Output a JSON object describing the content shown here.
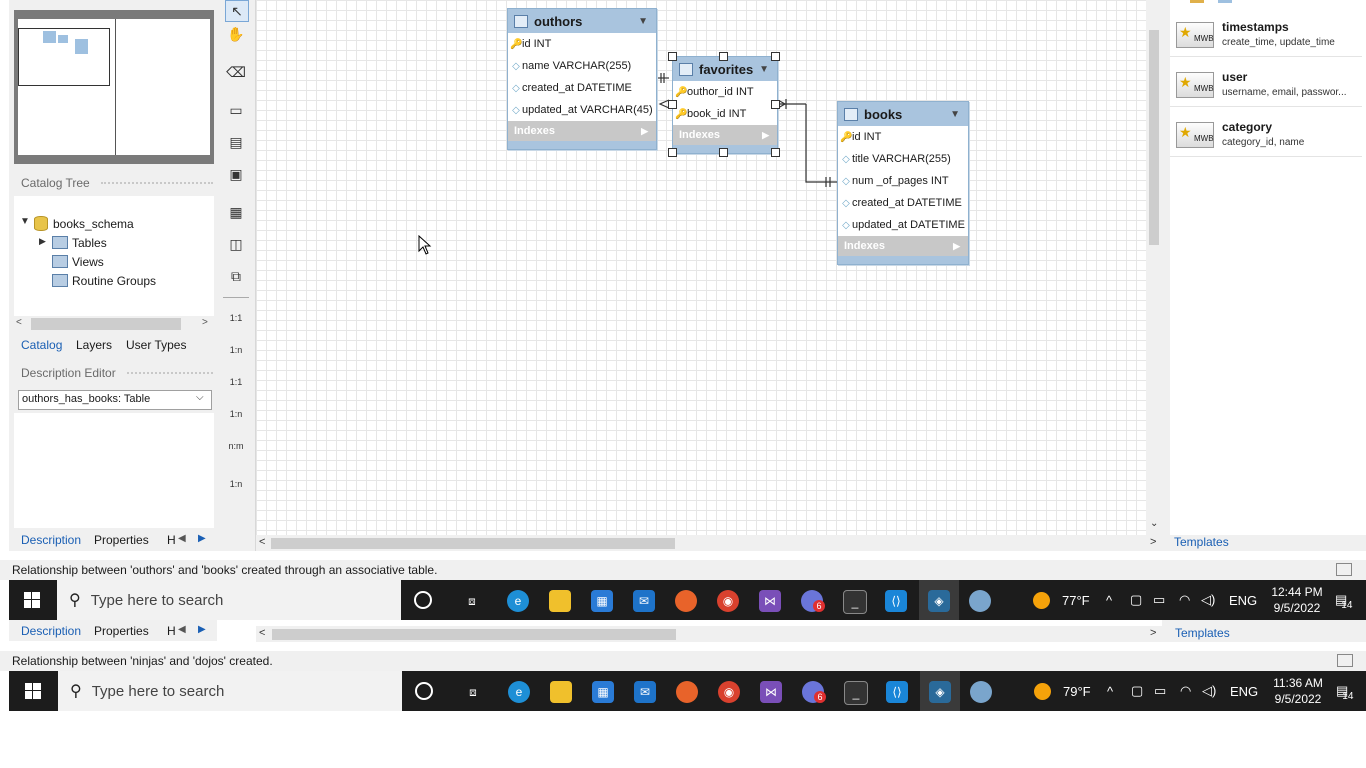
{
  "left_panel": {
    "catalog_tree_header": "Catalog Tree",
    "tree": {
      "schema": "books_schema",
      "children": [
        "Tables",
        "Views",
        "Routine Groups"
      ]
    },
    "tabs": [
      "Catalog",
      "Layers",
      "User Types"
    ],
    "description_editor_header": "Description Editor",
    "description_select": "outhors_has_books: Table",
    "bottom_tabs": [
      "Description",
      "Properties",
      "H"
    ]
  },
  "toolbar": {
    "labels": [
      "1:1",
      "1:n",
      "1:1",
      "1:n",
      "n:m",
      "1:n"
    ]
  },
  "entities": {
    "outhors": {
      "title": "outhors",
      "columns": [
        "id INT",
        "name VARCHAR(255)",
        "created_at DATETIME",
        "updated_at VARCHAR(45)"
      ],
      "indexes": "Indexes"
    },
    "favorites": {
      "title": "favorites",
      "columns": [
        "outhor_id INT",
        "book_id INT"
      ],
      "indexes": "Indexes"
    },
    "books": {
      "title": "books",
      "columns": [
        "id INT",
        "title VARCHAR(255)",
        "num _of_pages INT",
        "created_at DATETIME",
        "updated_at DATETIME"
      ],
      "indexes": "Indexes"
    }
  },
  "templates_panel": {
    "items": [
      {
        "title": "timestamps",
        "subtitle": "create_time, update_time"
      },
      {
        "title": "user",
        "subtitle": "username, email, passwor..."
      },
      {
        "title": "category",
        "subtitle": "category_id, name"
      }
    ],
    "icon_label": "MWB",
    "tab": "Templates"
  },
  "status_bar_1": "Relationship between 'outhors' and 'books' created through an associative table.",
  "taskbar_1": {
    "search_placeholder": "Type here to search",
    "weather": "77°F",
    "lang": "ENG",
    "time": "12:44 PM",
    "date": "9/5/2022",
    "notif": "14",
    "badge": "6"
  },
  "second_strip": {
    "bottom_tabs": [
      "Description",
      "Properties",
      "H"
    ],
    "templates_tab": "Templates",
    "status_bar": "Relationship between 'ninjas' and 'dojos' created."
  },
  "taskbar_2": {
    "search_placeholder": "Type here to search",
    "weather": "79°F",
    "lang": "ENG",
    "time": "11:36 AM",
    "date": "9/5/2022",
    "notif": "14",
    "badge": "6"
  },
  "colors": {
    "entity_header": "#a9c4de",
    "taskbar": "#1c1c1c",
    "link_blue": "#1a5fb4"
  }
}
